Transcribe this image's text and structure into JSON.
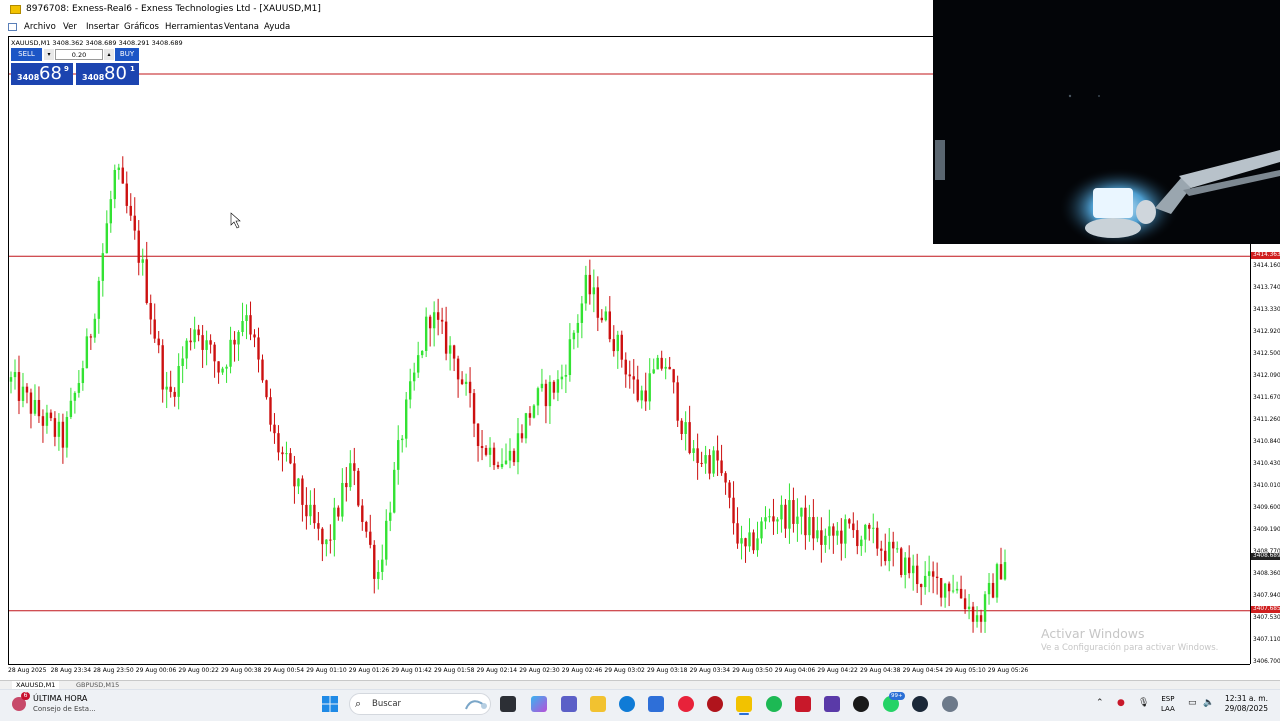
{
  "window": {
    "title": "8976708: Exness-Real6 - Exness Technologies Ltd - [XAUUSD,M1]"
  },
  "menu": {
    "items": [
      "Archivo",
      "Ver",
      "Insertar",
      "Gráficos",
      "Herramientas",
      "Ventana",
      "Ayuda"
    ]
  },
  "chart": {
    "symbol_info": "XAUUSD,M1  3408.362 3408.689 3408.291 3408.689",
    "trade_panel": {
      "sell_label": "SELL",
      "buy_label": "BUY",
      "lot_size": "0.20",
      "sell_price_small": "3408",
      "sell_price_big": "68",
      "sell_price_sup": "9",
      "buy_price_small": "3408",
      "buy_price_big": "80",
      "buy_price_sup": "1"
    },
    "colors": {
      "bull": "#33e233",
      "bear": "#cc1010",
      "hline": "#c0151a",
      "axis_tag": "#d01f1f",
      "bid_tag": "#222222"
    }
  },
  "chart_data": {
    "type": "candlestick",
    "symbol": "XAUUSD",
    "timeframe": "M1",
    "price_axis_ticks": [
      "3414.160",
      "3413.740",
      "3413.330",
      "3412.920",
      "3412.500",
      "3412.090",
      "3411.670",
      "3411.260",
      "3410.840",
      "3410.430",
      "3410.010",
      "3409.600",
      "3409.190",
      "3408.770",
      "3408.360",
      "3407.940",
      "3407.530",
      "3407.110",
      "3406.700"
    ],
    "highlighted_prices": {
      "hline_upper": "3414.363",
      "bid": "3408.689",
      "hline_lower": "3407.685"
    },
    "time_axis_labels": [
      "28 Aug 2025",
      "28 Aug 23:34",
      "28 Aug 23:50",
      "29 Aug 00:06",
      "29 Aug 00:22",
      "29 Aug 00:38",
      "29 Aug 00:54",
      "29 Aug 01:10",
      "29 Aug 01:26",
      "29 Aug 01:42",
      "29 Aug 01:58",
      "29 Aug 02:14",
      "29 Aug 02:30",
      "29 Aug 02:46",
      "29 Aug 03:02",
      "29 Aug 03:18",
      "29 Aug 03:34",
      "29 Aug 03:50",
      "29 Aug 04:06",
      "29 Aug 04:22",
      "29 Aug 04:38",
      "29 Aug 04:54",
      "29 Aug 05:10",
      "29 Aug 05:26"
    ],
    "price_path": [
      3412.0,
      3411.4,
      3410.9,
      3412.8,
      3416.0,
      3414.2,
      3411.6,
      3413.1,
      3412.2,
      3413.4,
      3411.0,
      3409.9,
      3408.8,
      3410.4,
      3408.3,
      3411.2,
      3413.3,
      3412.4,
      3410.8,
      3410.5,
      3411.6,
      3412.0,
      3413.8,
      3412.9,
      3411.7,
      3412.4,
      3410.6,
      3410.5,
      3408.7,
      3409.5,
      3409.5,
      3409.0,
      3409.2,
      3409.0,
      3408.6,
      3408.2,
      3408.2,
      3407.5,
      3408.7
    ]
  },
  "tabs": [
    "XAUUSD,M1",
    "GBPUSD,M15"
  ],
  "watermark": {
    "title": "Activar Windows",
    "subtitle": "Ve a Configuración para activar Windows."
  },
  "taskbar": {
    "news_badge": "6",
    "news_title": "ÚLTIMA HORA",
    "news_subtitle": "Consejo de Esta...",
    "search_placeholder": "Buscar",
    "lang_top": "ESP",
    "lang_bottom": "LAA",
    "time": "12:31 a. m.",
    "date": "29/08/2025",
    "chat_badge": "99+"
  }
}
